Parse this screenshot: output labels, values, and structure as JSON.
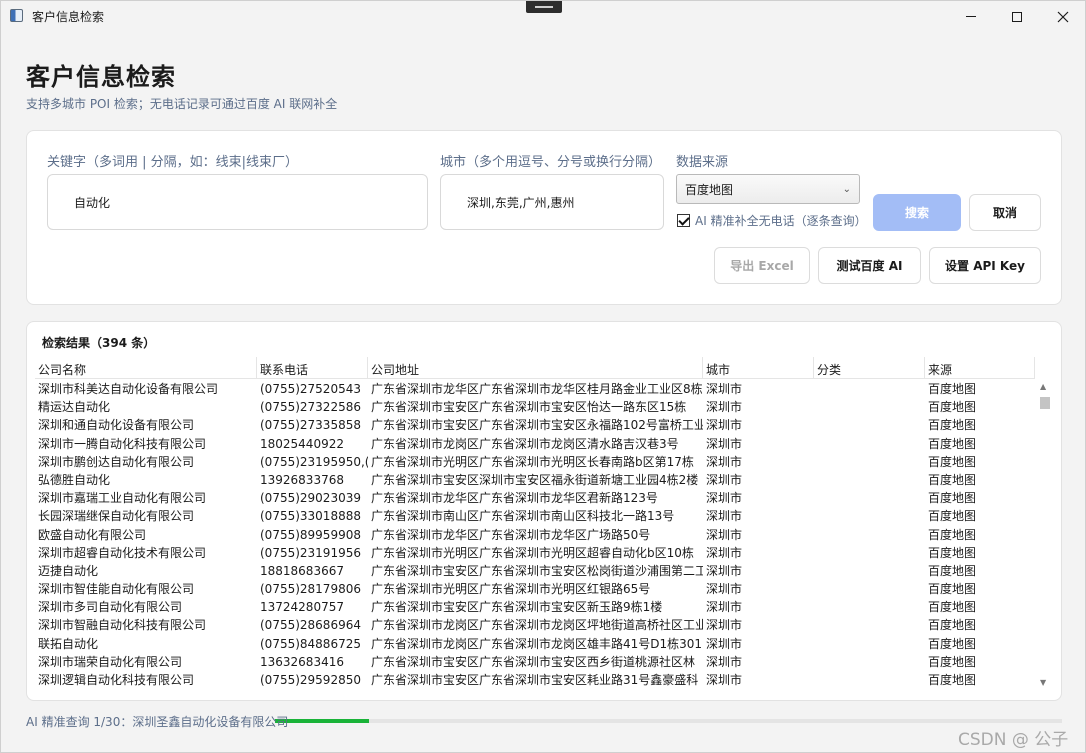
{
  "window": {
    "title": "客户信息检索"
  },
  "header": {
    "title": "客户信息检索",
    "subtitle": "支持多城市 POI 检索；无电话记录可通过百度 AI 联网补全"
  },
  "search": {
    "keyword_label": "关键字（多词用 | 分隔，如：线束|线束厂）",
    "keyword_value": "自动化",
    "city_label": "城市（多个用逗号、分号或换行分隔）",
    "city_value": "深圳,东莞,广州,惠州",
    "source_label": "数据来源",
    "source_value": "百度地图",
    "ai_checkbox_label": "AI 精准补全无电话（逐条查询）",
    "ai_checked": true,
    "buttons": {
      "search": "搜索",
      "cancel": "取消",
      "export": "导出 Excel",
      "test_ai": "测试百度 AI",
      "api_key": "设置 API Key"
    }
  },
  "results": {
    "title": "检索结果（394 条）",
    "columns": [
      "公司名称",
      "联系电话",
      "公司地址",
      "城市",
      "分类",
      "来源"
    ],
    "rows": [
      [
        "深圳市科美达自动化设备有限公司",
        "(0755)27520543",
        "广东省深圳市龙华区广东省深圳市龙华区桂月路金业工业区8栋",
        "深圳市",
        "",
        "百度地图"
      ],
      [
        "精运达自动化",
        "(0755)27322586",
        "广东省深圳市宝安区广东省深圳市宝安区怡达一路东区15栋",
        "深圳市",
        "",
        "百度地图"
      ],
      [
        "深圳和通自动化设备有限公司",
        "(0755)27335858",
        "广东省深圳市宝安区广东省深圳市宝安区永福路102号富桥工业",
        "深圳市",
        "",
        "百度地图"
      ],
      [
        "深圳市一腾自动化科技有限公司",
        "18025440922",
        "广东省深圳市龙岗区广东省深圳市龙岗区清水路吉汉巷3号",
        "深圳市",
        "",
        "百度地图"
      ],
      [
        "深圳市鹏创达自动化有限公司",
        "(0755)23195950,(0",
        "广东省深圳市光明区广东省深圳市光明区长春南路b区第17栋",
        "深圳市",
        "",
        "百度地图"
      ],
      [
        "弘德胜自动化",
        "13926833768",
        "广东省深圳市宝安区深圳市宝安区福永街道新塘工业园4栋2楼",
        "深圳市",
        "",
        "百度地图"
      ],
      [
        "深圳市嘉瑞工业自动化有限公司",
        "(0755)29023039",
        "广东省深圳市龙华区广东省深圳市龙华区君新路123号",
        "深圳市",
        "",
        "百度地图"
      ],
      [
        "长园深瑞继保自动化有限公司",
        "(0755)33018888",
        "广东省深圳市南山区广东省深圳市南山区科技北一路13号",
        "深圳市",
        "",
        "百度地图"
      ],
      [
        "欧盛自动化有限公司",
        "(0755)89959908",
        "广东省深圳市龙华区广东省深圳市龙华区广场路50号",
        "深圳市",
        "",
        "百度地图"
      ],
      [
        "深圳市超睿自动化技术有限公司",
        "(0755)23191956",
        "广东省深圳市光明区广东省深圳市光明区超睿自动化b区10栋",
        "深圳市",
        "",
        "百度地图"
      ],
      [
        "迈捷自动化",
        "18818683667",
        "广东省深圳市宝安区广东省深圳市宝安区松岗街道沙浦围第二工",
        "深圳市",
        "",
        "百度地图"
      ],
      [
        "深圳市智佳能自动化有限公司",
        "(0755)28179806",
        "广东省深圳市光明区广东省深圳市光明区红银路65号",
        "深圳市",
        "",
        "百度地图"
      ],
      [
        "深圳市多司自动化有限公司",
        "13724280757",
        "广东省深圳市宝安区广东省深圳市宝安区新玉路9栋1楼",
        "深圳市",
        "",
        "百度地图"
      ],
      [
        "深圳市智融自动化科技有限公司",
        "(0755)28686964",
        "广东省深圳市龙岗区广东省深圳市龙岗区坪地街道高桥社区工业",
        "深圳市",
        "",
        "百度地图"
      ],
      [
        "联拓自动化",
        "(0755)84886725",
        "广东省深圳市龙岗区广东省深圳市龙岗区雄丰路41号D1栋301",
        "深圳市",
        "",
        "百度地图"
      ],
      [
        "深圳市瑞荣自动化有限公司",
        "13632683416",
        "广东省深圳市宝安区广东省深圳市宝安区西乡街道桃源社区林",
        "深圳市",
        "",
        "百度地图"
      ],
      [
        "深圳逻辑自动化科技有限公司",
        "(0755)29592850",
        "广东省深圳市宝安区广东省深圳市宝安区耗业路31号鑫豪盛科",
        "深圳市",
        "",
        "百度地图"
      ]
    ]
  },
  "status": {
    "text": "AI 精准查询 1/30：深圳圣鑫自动化设备有限公司",
    "progress_fraction": 0.12
  },
  "watermark": "CSDN @ 公子",
  "colors": {
    "primary_button": "#a3bdf6",
    "progress": "#19b338",
    "label_text": "#5c6e8a"
  },
  "icons": [
    "app-icon",
    "minimize-icon",
    "maximize-icon",
    "close-icon",
    "chevron-down-icon",
    "checkbox-icon",
    "scroll-up-icon",
    "scroll-down-icon"
  ]
}
